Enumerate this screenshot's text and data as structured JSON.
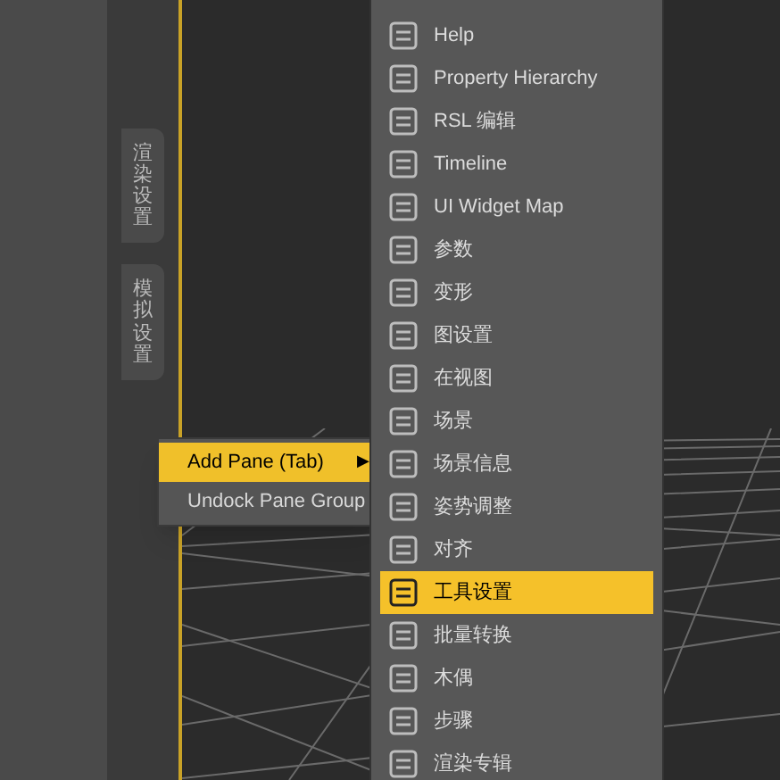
{
  "side_tabs": [
    {
      "label": "渲染设置"
    },
    {
      "label": "模拟设置"
    }
  ],
  "context_menu": {
    "items": [
      {
        "label": "Add Pane (Tab)",
        "selected": true,
        "arrow": "▶"
      },
      {
        "label": "Undock Pane Group",
        "selected": false
      }
    ]
  },
  "submenu": {
    "items": [
      {
        "label": "Help",
        "selected": false
      },
      {
        "label": "Property Hierarchy",
        "selected": false
      },
      {
        "label": "RSL 编辑",
        "selected": false
      },
      {
        "label": "Timeline",
        "selected": false
      },
      {
        "label": "UI Widget Map",
        "selected": false
      },
      {
        "label": "参数",
        "selected": false
      },
      {
        "label": "变形",
        "selected": false
      },
      {
        "label": "图设置",
        "selected": false
      },
      {
        "label": "在视图",
        "selected": false
      },
      {
        "label": "场景",
        "selected": false
      },
      {
        "label": "场景信息",
        "selected": false
      },
      {
        "label": "姿势调整",
        "selected": false
      },
      {
        "label": "对齐",
        "selected": false
      },
      {
        "label": "工具设置",
        "selected": true
      },
      {
        "label": "批量转换",
        "selected": false
      },
      {
        "label": "木偶",
        "selected": false
      },
      {
        "label": "步骤",
        "selected": false
      },
      {
        "label": "渲染专辑",
        "selected": false
      }
    ]
  }
}
